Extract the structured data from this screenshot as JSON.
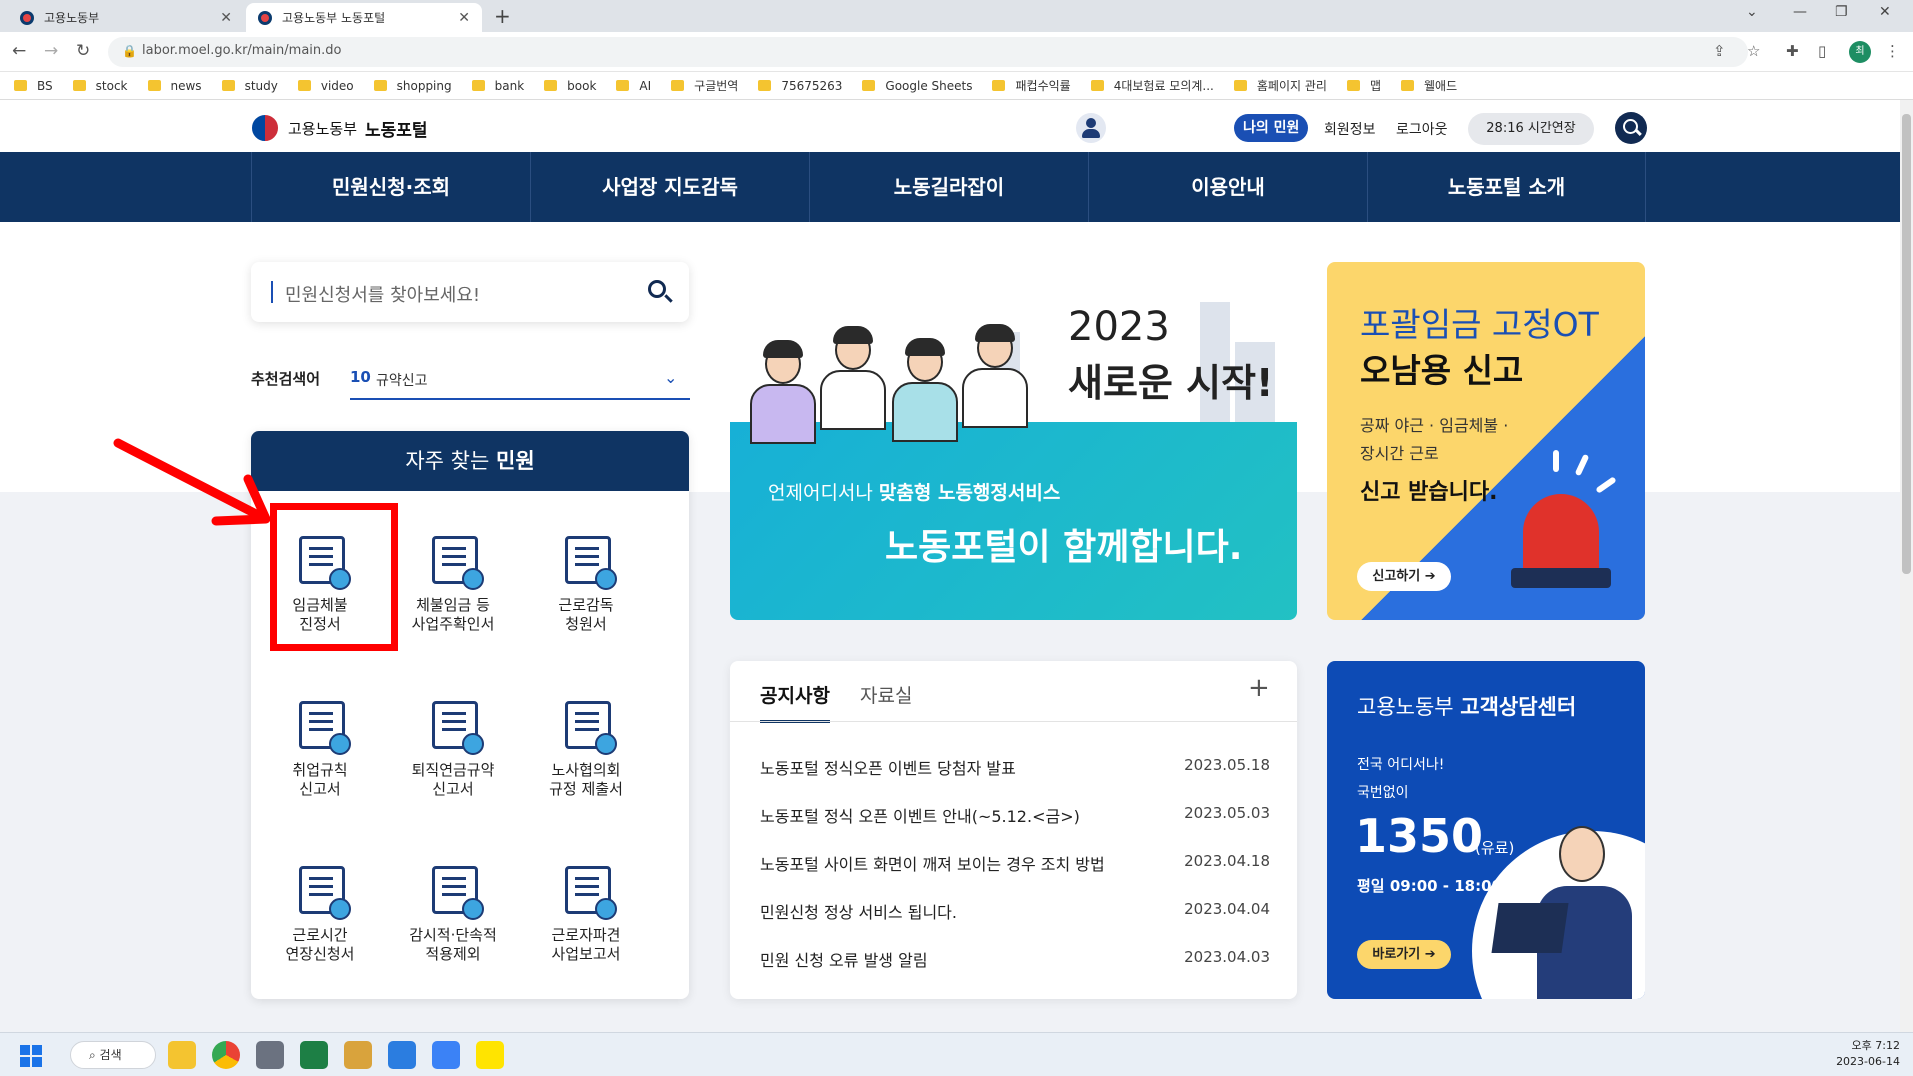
{
  "browser": {
    "tabs": [
      {
        "title": "고용노동부"
      },
      {
        "title": "고용노동부 노동포털"
      }
    ],
    "url": "labor.moel.go.kr/main/main.do",
    "bookmarks": [
      "BS",
      "stock",
      "news",
      "study",
      "video",
      "shopping",
      "bank",
      "book",
      "AI",
      "구글번역",
      "75675263",
      "Google Sheets",
      "패컵수익률",
      "4대보험료 모의계...",
      "홈페이지 관리",
      "맵",
      "웰애드"
    ],
    "profile_initial": "최"
  },
  "header": {
    "ministry": "고용노동부",
    "portal": "노동포털",
    "my_civil": "나의 민원",
    "member_info": "회원정보",
    "logout": "로그아웃",
    "session": "28:16 시간연장"
  },
  "gnb": [
    "민원신청·조회",
    "사업장 지도감독",
    "노동길라잡이",
    "이용안내",
    "노동포털 소개"
  ],
  "search": {
    "placeholder": "민원신청서를 찾아보세요!",
    "recommend_label": "추천검색어",
    "recommend_rank": "10",
    "recommend_keyword": "규약신고"
  },
  "frequent": {
    "title_plain": "자주 찾는",
    "title_bold": "민원",
    "items": [
      {
        "line1": "임금체불",
        "line2": "진정서",
        "icon": "wage-complaint-icon"
      },
      {
        "line1": "체불임금 등",
        "line2": "사업주확인서",
        "icon": "employer-confirm-icon"
      },
      {
        "line1": "근로감독",
        "line2": "청원서",
        "icon": "labor-inspection-icon"
      },
      {
        "line1": "취업규칙",
        "line2": "신고서",
        "icon": "work-rules-icon"
      },
      {
        "line1": "퇴직연금규약",
        "line2": "신고서",
        "icon": "pension-icon"
      },
      {
        "line1": "노사협의회",
        "line2": "규정 제출서",
        "icon": "council-icon"
      },
      {
        "line1": "근로시간",
        "line2": "연장신청서",
        "icon": "clock-icon"
      },
      {
        "line1": "감시적·단속적",
        "line2": "적용제외",
        "icon": "building-icon"
      },
      {
        "line1": "근로자파견",
        "line2": "사업보고서",
        "icon": "dispatch-icon"
      }
    ]
  },
  "banner": {
    "year": "2023",
    "headline": "새로운 시작!",
    "sub_plain": "언제어디서나 ",
    "sub_bold": "맞춤형 노동행정서비스",
    "big": "노동포털이 함께합니다."
  },
  "ot_banner": {
    "title1": "포괄임금 고정OT",
    "title2": "오남용 신고",
    "desc1": "공짜 야근 · 임금체불 ·",
    "desc2": "장시간 근로",
    "desc3": "신고 받습니다.",
    "button": "신고하기 ➔"
  },
  "notice": {
    "tab_active": "공지사항",
    "tab_other": "자료실",
    "more": "+",
    "rows": [
      {
        "title": "노동포털 정식오픈 이벤트 당첨자 발표",
        "date": "2023.05.18"
      },
      {
        "title": "노동포털 정식 오픈 이벤트 안내(~5.12.<금>)",
        "date": "2023.05.03"
      },
      {
        "title": "노동포털 사이트 화면이 깨져 보이는 경우 조치 방법",
        "date": "2023.04.18"
      },
      {
        "title": "민원신청 정상 서비스 됩니다.",
        "date": "2023.04.04"
      },
      {
        "title": "민원 신청 오류 발생 알림",
        "date": "2023.04.03"
      }
    ]
  },
  "call_center": {
    "title_plain": "고용노동부 ",
    "title_bold": "고객상담센터",
    "line1": "전국 어디서나!",
    "line2": "국번없이",
    "number": "1350",
    "paid": "(유료)",
    "hours": "평일 09:00 - 18:00",
    "button": "바로가기 ➔"
  },
  "taskbar": {
    "search": "검색",
    "time": "오후 7:12",
    "date": "2023-06-14"
  },
  "colors": {
    "navy": "#0f3463",
    "accent_blue": "#1a4fb4",
    "highlight_red": "#ff0000",
    "ot_yellow": "#fcd66b",
    "teal": "#17b0d6"
  }
}
